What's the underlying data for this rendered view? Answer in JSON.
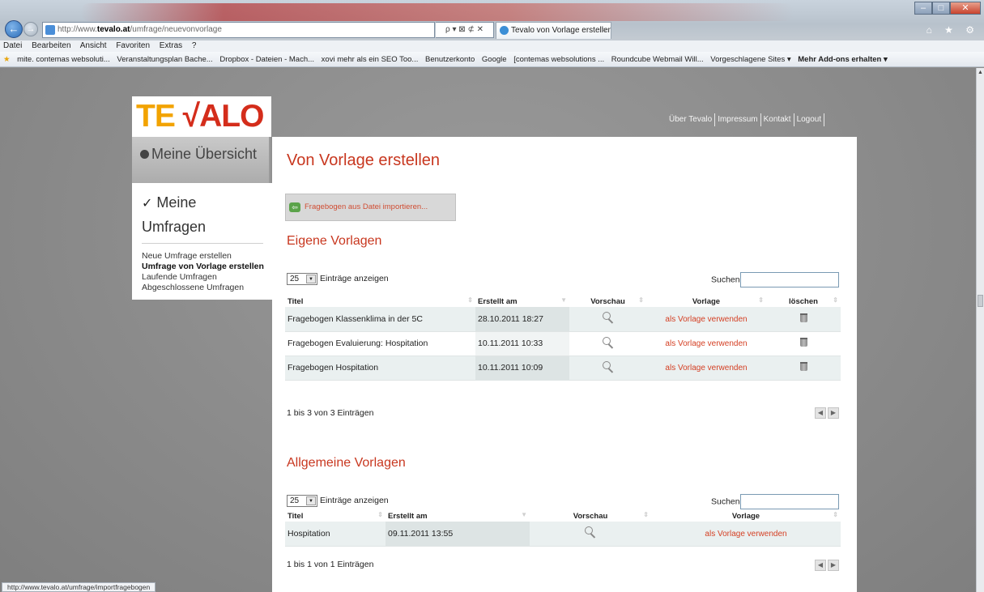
{
  "browser": {
    "address_prefix": "http://www.",
    "address_domain": "tevalo.at",
    "address_path": "/umfrage/neuevonvorlage",
    "address_tools": "ρ ▾ ⊠ ⊄ ✕",
    "tab_title": "Tevalo von Vorlage erstellen",
    "tab_close": "×",
    "back_icon": "←",
    "forward_icon": "→",
    "home_star_gear": "⌂ ★ ⚙",
    "win_min": "–",
    "win_max": "□",
    "win_close": "✕",
    "menu": [
      "Datei",
      "Bearbeiten",
      "Ansicht",
      "Favoriten",
      "Extras",
      "?"
    ],
    "favorites": [
      "mite. contemas websoluti...",
      "Veranstaltungsplan Bache...",
      "Dropbox - Dateien - Mach...",
      "xovi mehr als ein SEO Too...",
      "Benutzerkonto",
      "Google",
      "[contemas websolutions ...",
      "Roundcube Webmail Will...",
      "Vorgeschlagene Sites ▾",
      "Mehr Add-ons erhalten ▾"
    ],
    "status_url": "http://www.tevalo.at/umfrage/importfragebogen"
  },
  "site": {
    "logo_part1": "TE ",
    "logo_part2": "√ALO",
    "topnav": [
      "Über Tevalo",
      "Impressum",
      "Kontakt",
      "Logout"
    ],
    "sidebar": {
      "overview": "Meine Übersicht",
      "section_check": "✓",
      "section_title": "Meine Umfragen",
      "links": [
        "Neue Umfrage erstellen",
        "Umfrage von Vorlage erstellen",
        "Laufende Umfragen",
        "Abgeschlossene Umfragen"
      ]
    }
  },
  "page": {
    "title": "Von Vorlage erstellen",
    "import_button": "Fragebogen aus Datei importieren...",
    "own": {
      "heading": "Eigene Vorlagen",
      "length_value": "25",
      "length_label": "Einträge anzeigen",
      "search_label": "Suchen",
      "columns": [
        "Titel",
        "Erstellt am",
        "Vorschau",
        "Vorlage",
        "löschen"
      ],
      "rows": [
        {
          "title": "Fragebogen Klassenklima in der 5C",
          "created": "28.10.2011 18:27",
          "use": "als Vorlage verwenden"
        },
        {
          "title": "Fragebogen Evaluierung: Hospitation",
          "created": "10.11.2011 10:33",
          "use": "als Vorlage verwenden"
        },
        {
          "title": "Fragebogen Hospitation",
          "created": "10.11.2011 10:09",
          "use": "als Vorlage verwenden"
        }
      ],
      "info": "1 bis 3 von 3 Einträgen"
    },
    "general": {
      "heading": "Allgemeine Vorlagen",
      "length_value": "25",
      "length_label": "Einträge anzeigen",
      "search_label": "Suchen",
      "columns": [
        "Titel",
        "Erstellt am",
        "Vorschau",
        "Vorlage"
      ],
      "rows": [
        {
          "title": "Hospitation",
          "created": "09.11.2011 13:55",
          "use": "als Vorlage verwenden"
        }
      ],
      "info": "1 bis 1 von 1 Einträgen"
    }
  },
  "colors": {
    "accent_red": "#c8371f",
    "logo_orange": "#f2a300",
    "row_highlight": "#eaf0f0"
  }
}
